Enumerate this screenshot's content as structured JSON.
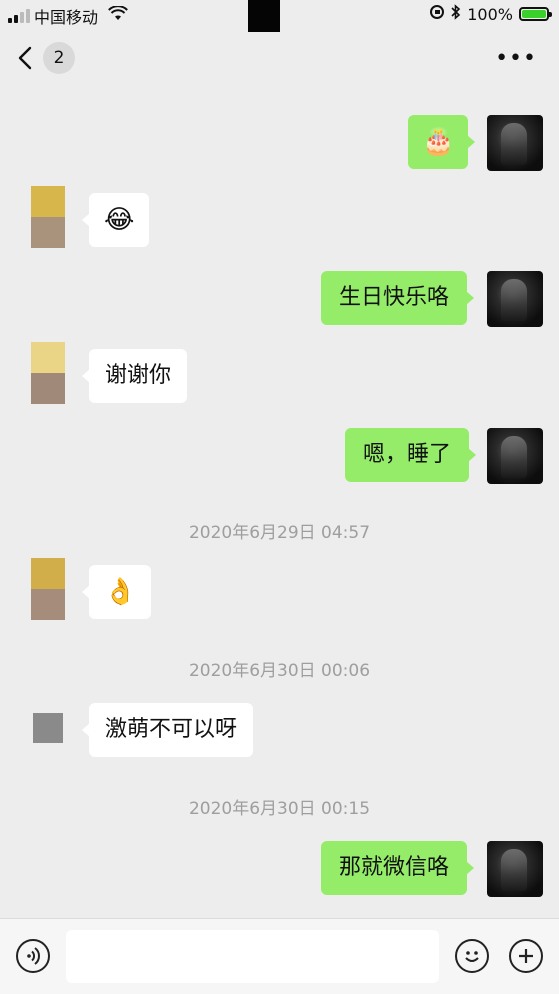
{
  "status_bar": {
    "carrier": "中国移动",
    "battery_text": "100%",
    "battery_level": 1.0,
    "battery_color": "#3bd12d"
  },
  "nav": {
    "unread_count": "2",
    "more_label": "•••"
  },
  "messages": [
    {
      "side": "out",
      "text": "🎂"
    },
    {
      "side": "in",
      "text": "😂"
    },
    {
      "side": "out",
      "text": "生日快乐咯"
    },
    {
      "side": "in",
      "text": "谢谢你"
    },
    {
      "side": "out",
      "text": "嗯，睡了"
    },
    {
      "timestamp": "2020年6月29日 04:57"
    },
    {
      "side": "in",
      "text": "👌"
    },
    {
      "timestamp": "2020年6月30日 00:06"
    },
    {
      "side": "in",
      "text": "激萌不可以呀"
    },
    {
      "timestamp": "2020年6月30日 00:15"
    },
    {
      "side": "out",
      "text": "那就微信咯"
    }
  ],
  "input": {
    "value": "",
    "placeholder": ""
  },
  "colors": {
    "outgoing_bubble": "#95ec69",
    "incoming_bubble": "#ffffff",
    "background": "#ededed",
    "timestamp_text": "#9e9e9e"
  },
  "icons": [
    "back-chevron-icon",
    "more-icon",
    "voice-icon",
    "emoji-icon",
    "plus-icon",
    "wifi-icon",
    "bluetooth-icon",
    "orientation-lock-icon"
  ]
}
